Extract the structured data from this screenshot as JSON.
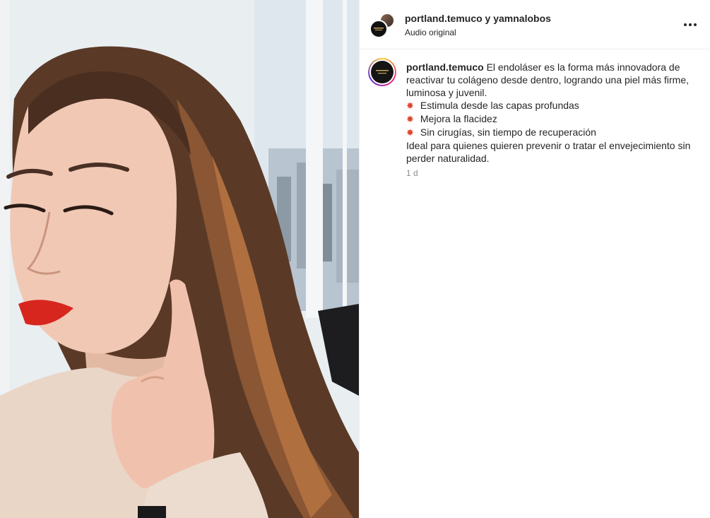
{
  "header": {
    "title": "portland.temuco y yamnalobos",
    "subtitle": "Audio original",
    "more_icon": "more-horizontal-icon"
  },
  "caption": {
    "username": "portland.temuco",
    "intro": "El endoláser es la forma más innovadora de reactivar tu colágeno desde dentro, logrando una piel más firme, luminosa y juvenil.",
    "bullets": [
      "Estimula desde las capas profundas",
      "Mejora la flacidez",
      "Sin cirugías, sin tiempo de recuperación"
    ],
    "bullet_icon": "collision-emoji",
    "outro": "Ideal para quienes quieren prevenir o tratar el envejecimiento sin perder naturalidad."
  },
  "timestamp": "1 d",
  "colors": {
    "text": "#262626",
    "muted": "#8e8e8e",
    "divider": "#efefef",
    "bullet": "#e0452c"
  }
}
